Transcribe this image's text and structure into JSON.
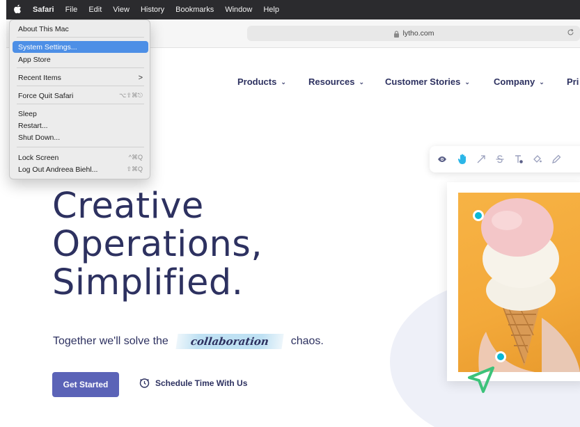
{
  "menubar": {
    "apple": "",
    "items": [
      "Safari",
      "File",
      "Edit",
      "View",
      "History",
      "Bookmarks",
      "Window",
      "Help"
    ]
  },
  "browser": {
    "address": "lytho.com",
    "reload_icon": "reload-icon"
  },
  "apple_menu": {
    "items": [
      {
        "label": "About This Mac",
        "shortcut": ""
      },
      {
        "label": "System Settings...",
        "shortcut": "",
        "selected": true
      },
      {
        "label": "App Store",
        "shortcut": ""
      },
      {
        "label": "Recent Items",
        "shortcut": "",
        "submenu": true
      },
      {
        "label": "Force Quit Safari",
        "shortcut": "⌥⇧⌘⎋"
      },
      {
        "label": "Sleep",
        "shortcut": ""
      },
      {
        "label": "Restart...",
        "shortcut": ""
      },
      {
        "label": "Shut Down...",
        "shortcut": ""
      },
      {
        "label": "Lock Screen",
        "shortcut": "^⌘Q"
      },
      {
        "label": "Log Out Andreea Biehl...",
        "shortcut": "⇧⌘Q"
      }
    ],
    "submenu_arrow": ">"
  },
  "nav": {
    "items": [
      "Products",
      "Resources",
      "Customer Stories",
      "Company",
      "Pri"
    ],
    "chevron": "⌄"
  },
  "hero": {
    "title_lines": [
      "Creative",
      "Operations,",
      "Simplified."
    ],
    "tagline_before": "Together we'll solve the",
    "tagline_highlight": "collaboration",
    "tagline_after": "chaos.",
    "cta_primary": "Get Started",
    "cta_secondary": "Schedule Time With Us"
  },
  "colors": {
    "brand_navy": "#2d3160",
    "button": "#5b63b7",
    "marker": "#0bb8d4",
    "cursor": "#3cc27a",
    "menu_highlight": "#4d8fe6"
  },
  "icons": [
    "apple-icon",
    "lock-icon",
    "reload-icon",
    "eye-icon",
    "hand-icon",
    "arrow-icon",
    "strikethrough-icon",
    "text-icon",
    "fill-icon",
    "pen-icon",
    "clock-icon",
    "cursor-icon"
  ]
}
